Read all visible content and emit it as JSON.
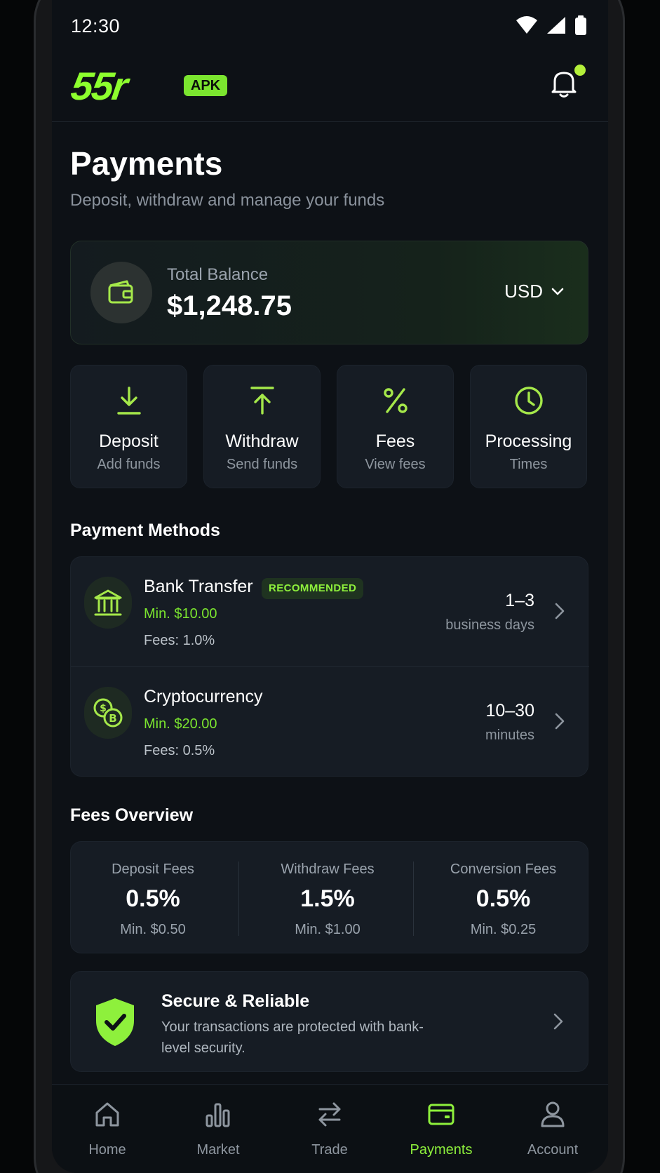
{
  "status_bar": {
    "time": "12:30"
  },
  "header": {
    "logo": "55r",
    "badge": "APK"
  },
  "page": {
    "title": "Payments",
    "subtitle": "Deposit, withdraw and manage your funds"
  },
  "balance": {
    "label": "Total Balance",
    "value": "$1,248.75",
    "currency": "USD"
  },
  "actions": [
    {
      "title": "Deposit",
      "subtitle": "Add funds",
      "icon": "download-icon"
    },
    {
      "title": "Withdraw",
      "subtitle": "Send funds",
      "icon": "upload-icon"
    },
    {
      "title": "Fees",
      "subtitle": "View fees",
      "icon": "percent-icon"
    },
    {
      "title": "Processing",
      "subtitle": "Times",
      "icon": "clock-icon"
    }
  ],
  "payment_methods": {
    "title": "Payment Methods",
    "items": [
      {
        "name": "Bank Transfer",
        "badge": "RECOMMENDED",
        "min": "Min. $10.00",
        "fees": "Fees: 1.0%",
        "time": "1–3",
        "unit": "business days",
        "icon": "bank-icon"
      },
      {
        "name": "Cryptocurrency",
        "min": "Min. $20.00",
        "fees": "Fees: 0.5%",
        "time": "10–30",
        "unit": "minutes",
        "icon": "crypto-coins-icon"
      }
    ]
  },
  "fees_overview": {
    "title": "Fees Overview",
    "items": [
      {
        "label": "Deposit Fees",
        "value": "0.5%",
        "min": "Min. $0.50"
      },
      {
        "label": "Withdraw Fees",
        "value": "1.5%",
        "min": "Min. $1.00"
      },
      {
        "label": "Conversion Fees",
        "value": "0.5%",
        "min": "Min. $0.25"
      }
    ]
  },
  "secure": {
    "title": "Secure & Reliable",
    "text": "Your transactions are protected with bank-level security."
  },
  "nav": [
    {
      "label": "Home",
      "icon": "home-icon"
    },
    {
      "label": "Market",
      "icon": "bar-chart-icon"
    },
    {
      "label": "Trade",
      "icon": "swap-icon"
    },
    {
      "label": "Payments",
      "icon": "card-icon",
      "active": true
    },
    {
      "label": "Account",
      "icon": "user-icon"
    }
  ],
  "colors": {
    "accent": "#8ef03c",
    "background": "#0d1116",
    "card": "#161c24"
  }
}
